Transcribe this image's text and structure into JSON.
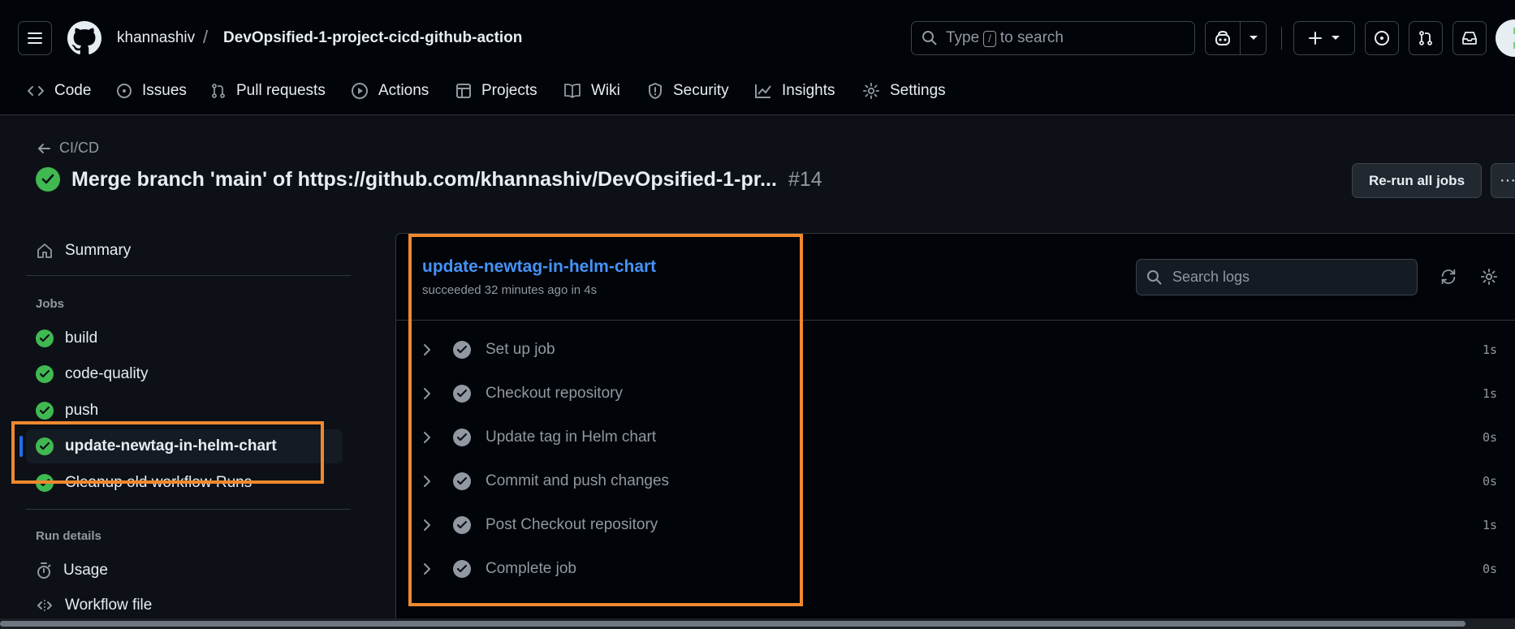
{
  "header": {
    "owner": "khannashiv",
    "separator": "/",
    "repo": "DevOpsified-1-project-cicd-github-action",
    "search_prefix": "Type",
    "search_key": "/",
    "search_suffix": "to search"
  },
  "tabs": [
    {
      "label": "Code",
      "icon": "code-icon"
    },
    {
      "label": "Issues",
      "icon": "issue-opened-icon"
    },
    {
      "label": "Pull requests",
      "icon": "git-pull-request-icon"
    },
    {
      "label": "Actions",
      "icon": "play-icon"
    },
    {
      "label": "Projects",
      "icon": "table-icon"
    },
    {
      "label": "Wiki",
      "icon": "book-icon"
    },
    {
      "label": "Security",
      "icon": "shield-icon"
    },
    {
      "label": "Insights",
      "icon": "graph-icon"
    },
    {
      "label": "Settings",
      "icon": "gear-icon"
    }
  ],
  "run": {
    "back_label": "CI/CD",
    "title": "Merge branch 'main' of https://github.com/khannashiv/DevOpsified-1-pr...",
    "number": "#14",
    "rerun_label": "Re-run all jobs",
    "more_label": "···"
  },
  "sidebar": {
    "summary_label": "Summary",
    "jobs_heading": "Jobs",
    "jobs": [
      {
        "label": "build",
        "status": "success"
      },
      {
        "label": "code-quality",
        "status": "success"
      },
      {
        "label": "push",
        "status": "success"
      },
      {
        "label": "update-newtag-in-helm-chart",
        "status": "success",
        "selected": true
      },
      {
        "label": "Cleanup old workflow Runs",
        "status": "success"
      }
    ],
    "run_details_heading": "Run details",
    "usage_label": "Usage",
    "workflow_file_label": "Workflow file"
  },
  "job": {
    "name": "update-newtag-in-helm-chart",
    "status_text": "succeeded 32 minutes ago in 4s",
    "search_placeholder": "Search logs",
    "steps": [
      {
        "label": "Set up job",
        "duration": "1s"
      },
      {
        "label": "Checkout repository",
        "duration": "1s"
      },
      {
        "label": "Update tag in Helm chart",
        "duration": "0s"
      },
      {
        "label": "Commit and push changes",
        "duration": "0s"
      },
      {
        "label": "Post Checkout repository",
        "duration": "1s"
      },
      {
        "label": "Complete job",
        "duration": "0s"
      }
    ]
  },
  "colors": {
    "background": "#0d1117",
    "header_bg": "#010409",
    "success": "#3fb950",
    "link": "#4493f8",
    "annotation": "#f0882e",
    "selection_bar": "#1f6feb"
  }
}
